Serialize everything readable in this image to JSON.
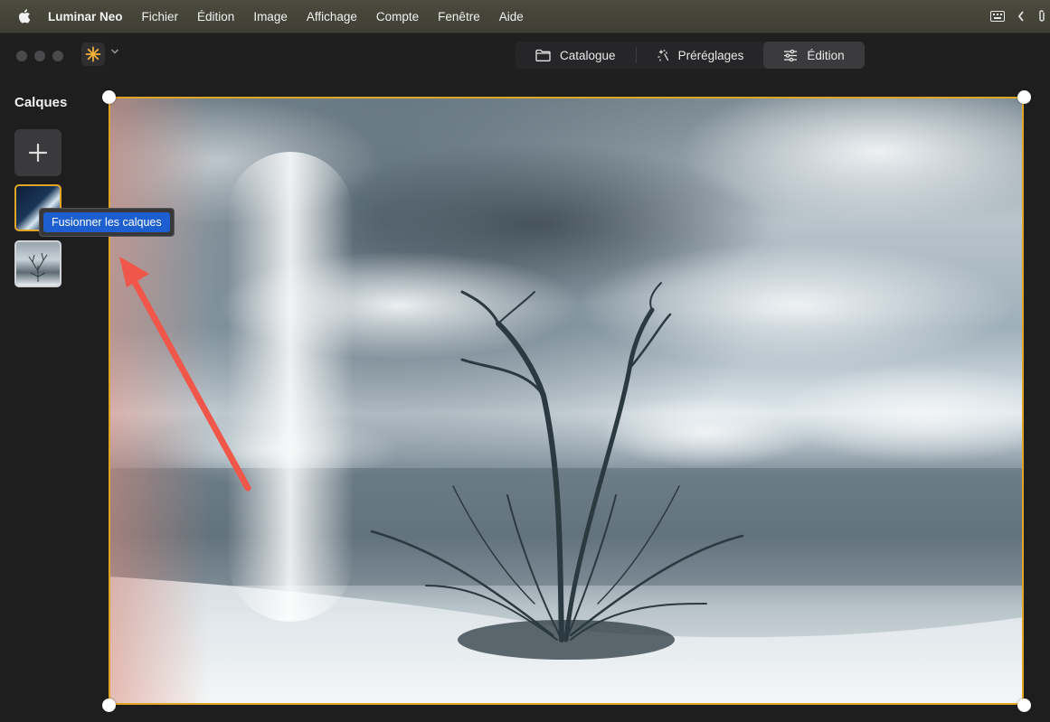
{
  "menubar": {
    "items": [
      "Luminar Neo",
      "Fichier",
      "Édition",
      "Image",
      "Affichage",
      "Compte",
      "Fenêtre",
      "Aide"
    ]
  },
  "toolbar": {
    "tabs": [
      {
        "label": "Catalogue",
        "icon": "folder-icon",
        "active": false
      },
      {
        "label": "Préréglages",
        "icon": "sparkle-icon",
        "active": false
      },
      {
        "label": "Édition",
        "icon": "sliders-icon",
        "active": true
      }
    ]
  },
  "layers": {
    "title": "Calques",
    "tooltip": "Fusionner les calques"
  },
  "colors": {
    "selection": "#e0a526",
    "tooltip_bg": "#1d5fd0",
    "arrow": "#f0564a",
    "logo": "#f2b23a"
  }
}
